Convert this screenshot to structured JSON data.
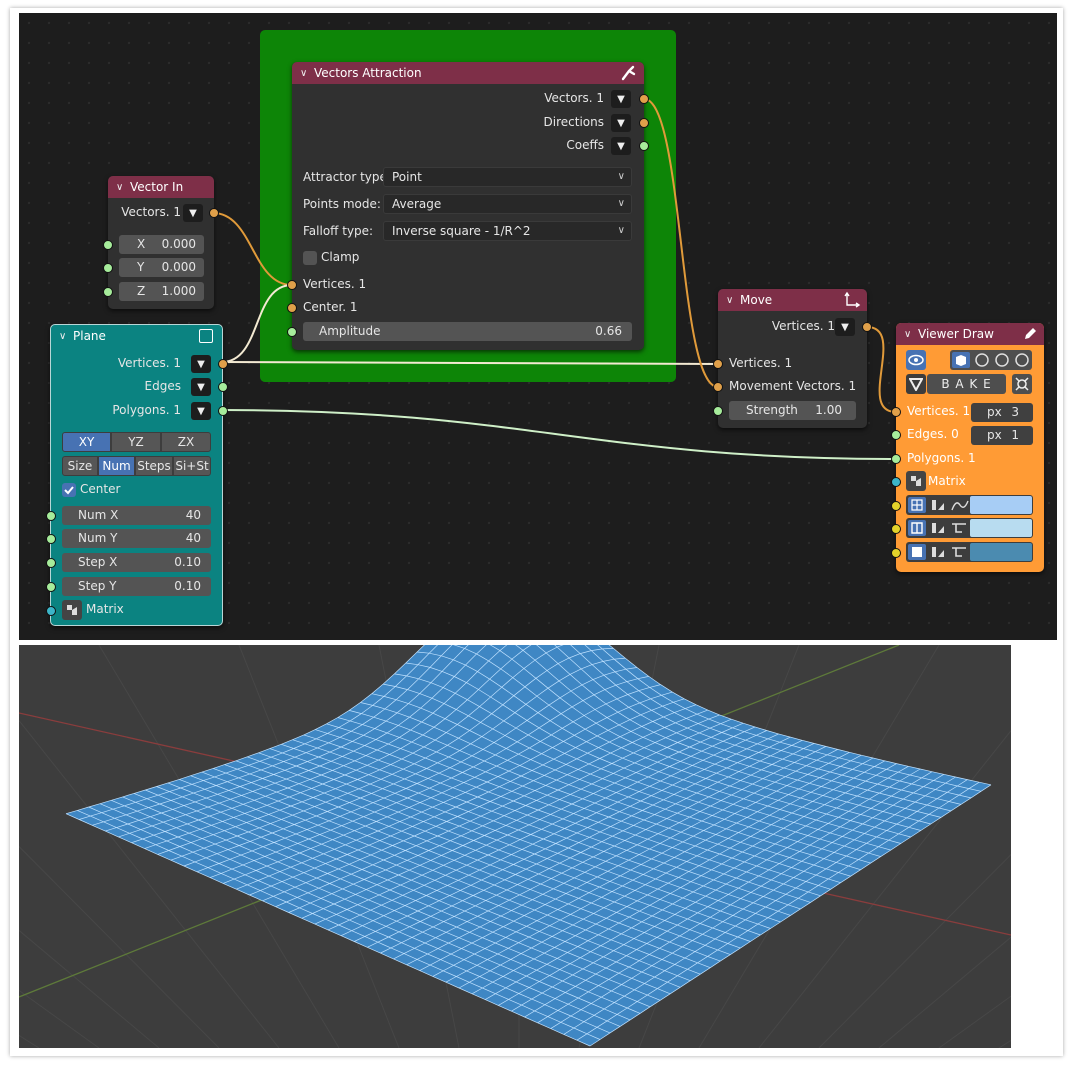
{
  "colors": {
    "header_red": "#7e2f48",
    "plane_teal": "#0b8381",
    "viewer_orange": "#ff9b35",
    "frame_green": "#0d8507",
    "socket_orange": "#e0a04a",
    "socket_green": "#a6ec9b",
    "socket_teal": "#3cb5c8",
    "socket_yellow": "#e3d22a",
    "wire_orange": "#e09a3a",
    "wire_light": "#f3ead2",
    "wire_green": "#cff0c8",
    "mesh_blue": "#3f87c4",
    "mesh_line": "#bfe1ff"
  },
  "vectors_attraction": {
    "title": "Vectors Attraction",
    "outputs": [
      "Vectors. 1",
      "Directions",
      "Coeffs"
    ],
    "attractor_type_label": "Attractor type:",
    "attractor_type_value": "Point",
    "points_mode_label": "Points mode:",
    "points_mode_value": "Average",
    "falloff_type_label": "Falloff type:",
    "falloff_type_value": "Inverse square - 1/R^2",
    "clamp_label": "Clamp",
    "inputs": [
      "Vertices. 1",
      "Center. 1"
    ],
    "amplitude_label": "Amplitude",
    "amplitude_value": "0.66"
  },
  "vector_in": {
    "title": "Vector In",
    "output": "Vectors. 1",
    "x_label": "X",
    "x_value": "0.000",
    "y_label": "Y",
    "y_value": "0.000",
    "z_label": "Z",
    "z_value": "1.000"
  },
  "plane": {
    "title": "Plane",
    "outputs": [
      "Vertices. 1",
      "Edges",
      "Polygons. 1"
    ],
    "planes": [
      "XY",
      "YZ",
      "ZX"
    ],
    "modes": [
      "Size",
      "Num",
      "Steps",
      "Si+St"
    ],
    "center_label": "Center",
    "num_x_label": "Num X",
    "num_x_value": "40",
    "num_y_label": "Num Y",
    "num_y_value": "40",
    "step_x_label": "Step X",
    "step_x_value": "0.10",
    "step_y_label": "Step Y",
    "step_y_value": "0.10",
    "matrix_label": "Matrix"
  },
  "move": {
    "title": "Move",
    "output": "Vertices. 1",
    "inputs": [
      "Vertices. 1",
      "Movement Vectors. 1"
    ],
    "strength_label": "Strength",
    "strength_value": "1.00"
  },
  "viewer_draw": {
    "title": "Viewer Draw",
    "bake_label": "B A K E",
    "vertices_label": "Vertices. 1",
    "edges_label": "Edges. 0",
    "polygons_label": "Polygons. 1",
    "matrix_label": "Matrix",
    "px_label": "px",
    "vertex_size": "3",
    "edge_width": "1",
    "color_rows": [
      "#a7cdf5",
      "#b8dcf0",
      "#4b8bb0"
    ]
  }
}
